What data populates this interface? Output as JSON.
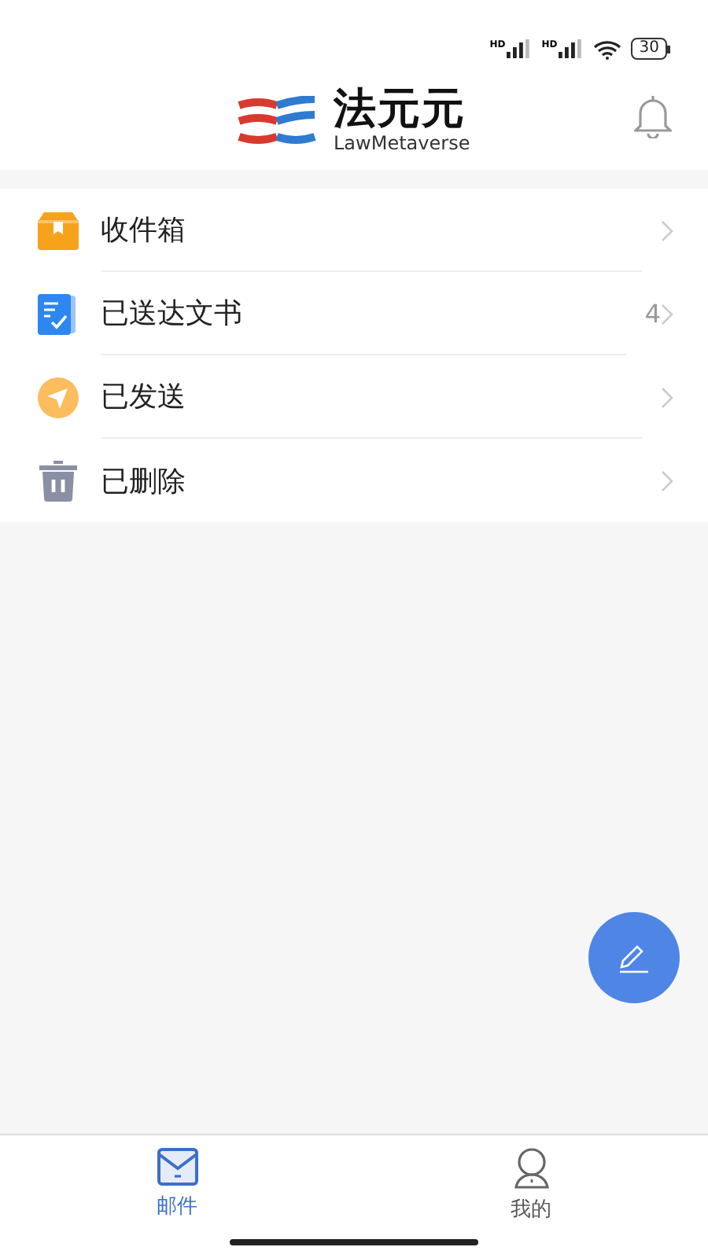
{
  "status_bar": {
    "signal_labels": [
      "HD",
      "HD"
    ],
    "battery": "30"
  },
  "header": {
    "logo_title": "法元元",
    "logo_subtitle": "LawMetaverse"
  },
  "folders": [
    {
      "kind": "inbox",
      "label": "收件箱"
    },
    {
      "kind": "served",
      "label": "已送达文书",
      "count": "4"
    },
    {
      "kind": "sent",
      "label": "已发送"
    },
    {
      "kind": "deleted",
      "label": "已删除"
    }
  ],
  "tabs": [
    {
      "kind": "mail",
      "label": "邮件",
      "selected": true
    },
    {
      "kind": "me",
      "label": "我的",
      "selected": false
    }
  ]
}
